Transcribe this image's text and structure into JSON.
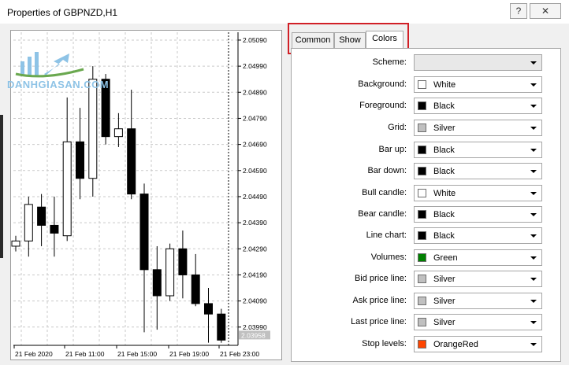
{
  "window": {
    "title": "Properties of GBPNZD,H1",
    "help": "?",
    "close": "✕"
  },
  "watermark": {
    "text": "DANHGIASAN.COM"
  },
  "tabs": [
    {
      "label": "Common",
      "active": false
    },
    {
      "label": "Show",
      "active": false
    },
    {
      "label": "Colors",
      "active": true
    }
  ],
  "colors": {
    "scheme": {
      "label": "Scheme:",
      "value": ""
    },
    "rows": [
      {
        "label": "Background:",
        "value": "White",
        "swatch": "#ffffff"
      },
      {
        "label": "Foreground:",
        "value": "Black",
        "swatch": "#000000"
      },
      {
        "label": "Grid:",
        "value": "Silver",
        "swatch": "#c0c0c0"
      },
      {
        "label": "Bar up:",
        "value": "Black",
        "swatch": "#000000"
      },
      {
        "label": "Bar down:",
        "value": "Black",
        "swatch": "#000000"
      },
      {
        "label": "Bull candle:",
        "value": "White",
        "swatch": "#ffffff"
      },
      {
        "label": "Bear candle:",
        "value": "Black",
        "swatch": "#000000"
      },
      {
        "label": "Line chart:",
        "value": "Black",
        "swatch": "#000000"
      },
      {
        "label": "Volumes:",
        "value": "Green",
        "swatch": "#008000"
      },
      {
        "label": "Bid price line:",
        "value": "Silver",
        "swatch": "#c0c0c0"
      },
      {
        "label": "Ask price line:",
        "value": "Silver",
        "swatch": "#c0c0c0"
      },
      {
        "label": "Last price line:",
        "value": "Silver",
        "swatch": "#c0c0c0"
      },
      {
        "label": "Stop levels:",
        "value": "OrangeRed",
        "swatch": "#ff4500"
      }
    ]
  },
  "chart_data": {
    "type": "candlestick",
    "title": "",
    "ylim": [
      2.0392,
      2.0512
    ],
    "y_ticks": [
      "2.05090",
      "2.04990",
      "2.04890",
      "2.04790",
      "2.04690",
      "2.04590",
      "2.04490",
      "2.04390",
      "2.04290",
      "2.04190",
      "2.04090",
      "2.03990"
    ],
    "current_price": "2.03958",
    "x_ticks": [
      "21 Feb 2020",
      "21 Feb 11:00",
      "21 Feb 15:00",
      "21 Feb 19:00",
      "21 Feb 23:00"
    ],
    "candles": [
      {
        "o": 2.043,
        "h": 2.0434,
        "l": 2.0428,
        "c": 2.0432
      },
      {
        "o": 2.0432,
        "h": 2.0449,
        "l": 2.0426,
        "c": 2.0446
      },
      {
        "o": 2.0445,
        "h": 2.045,
        "l": 2.043,
        "c": 2.0438
      },
      {
        "o": 2.0438,
        "h": 2.0449,
        "l": 2.0426,
        "c": 2.0435
      },
      {
        "o": 2.0434,
        "h": 2.0487,
        "l": 2.0432,
        "c": 2.047
      },
      {
        "o": 2.047,
        "h": 2.0483,
        "l": 2.0448,
        "c": 2.0456
      },
      {
        "o": 2.0456,
        "h": 2.0499,
        "l": 2.0449,
        "c": 2.0494
      },
      {
        "o": 2.0494,
        "h": 2.0496,
        "l": 2.0469,
        "c": 2.0472
      },
      {
        "o": 2.0472,
        "h": 2.0481,
        "l": 2.0468,
        "c": 2.0475
      },
      {
        "o": 2.0475,
        "h": 2.049,
        "l": 2.0448,
        "c": 2.045
      },
      {
        "o": 2.045,
        "h": 2.0454,
        "l": 2.0397,
        "c": 2.0421
      },
      {
        "o": 2.0421,
        "h": 2.043,
        "l": 2.0398,
        "c": 2.0411
      },
      {
        "o": 2.0411,
        "h": 2.0431,
        "l": 2.0409,
        "c": 2.0429
      },
      {
        "o": 2.0429,
        "h": 2.0436,
        "l": 2.041,
        "c": 2.0419
      },
      {
        "o": 2.0419,
        "h": 2.0427,
        "l": 2.0407,
        "c": 2.0408
      },
      {
        "o": 2.0408,
        "h": 2.0414,
        "l": 2.0393,
        "c": 2.0404
      },
      {
        "o": 2.0404,
        "h": 2.0406,
        "l": 2.0393,
        "c": 2.0394
      }
    ]
  }
}
